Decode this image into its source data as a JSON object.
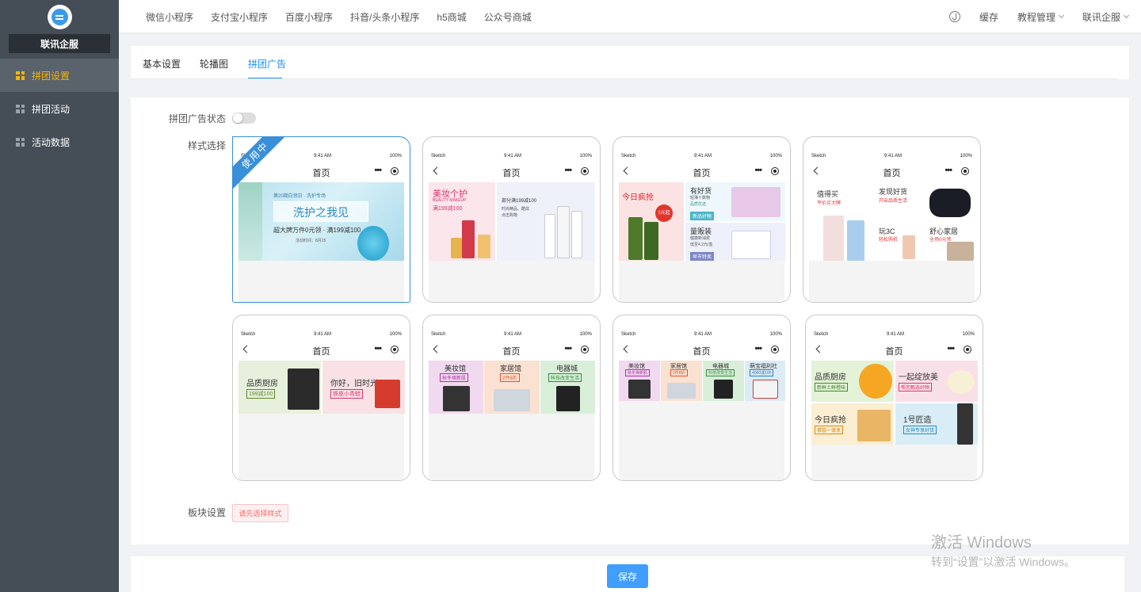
{
  "sidebar": {
    "brand": "联讯企服",
    "items": [
      {
        "label": "拼团设置",
        "icon": "grid-icon",
        "active": true
      },
      {
        "label": "拼团活动",
        "icon": "grid-icon",
        "active": false
      },
      {
        "label": "活动数据",
        "icon": "grid-icon",
        "active": false
      }
    ]
  },
  "topbar": {
    "tabs": [
      "微信小程序",
      "支付宝小程序",
      "百度小程序",
      "抖音/头条小程序",
      "h5商城",
      "公众号商城"
    ],
    "download_icon": "download-icon",
    "cache": "缓存",
    "tutorial": "教程管理",
    "user": "联讯企服"
  },
  "subtabs": [
    "基本设置",
    "轮播图",
    "拼团广告"
  ],
  "form": {
    "status_label": "拼团广告状态",
    "style_label": "样式选择",
    "block_label": "板块设置",
    "block_button": "请先选择样式"
  },
  "phone": {
    "carrier": "Sketch",
    "time": "9:41 AM",
    "battery": "100%",
    "title": "首页",
    "dots": "•••",
    "in_use": "使用中"
  },
  "styles": {
    "s1": {
      "top": "第20期白领日 · 洗护专场",
      "main": "洗护之我见",
      "sub": "超大牌万件0元领 · 满199减100",
      "small": "活动时间：8月25"
    },
    "s2": {
      "t1": "美妆个护",
      "t1en": "BEAUTY MAKEUP",
      "t1b": "满199减100",
      "t2": "部分满199减100",
      "t2b": "时尚精品、酷炫",
      "t2c": "点击购物"
    },
    "s3": {
      "t1": "今日疯抢",
      "badge": "1元起",
      "t2": "有好货",
      "t2b": "轻薄十数物",
      "t2c": "品质优选",
      "t2tag": "新品好物",
      "t3": "量贩装",
      "t3b": "健康新消费",
      "t3c": "低至4.2元/盒",
      "t3tag": "早市特卖"
    },
    "s4": {
      "t1": "值得买",
      "t1b": "平价买大牌",
      "t2": "发现好货",
      "t2b": "开启品质生活",
      "t3": "玩3C",
      "t3b": "轻松购机",
      "t4": "舒心家居",
      "t4b": "全场0元领"
    },
    "s5": {
      "t1": "品质厨房",
      "t1tag": "199减100",
      "t2": "你好，旧时光",
      "t2tag": "铁皮小青蛙"
    },
    "s6": {
      "t1": "美妆馆",
      "t1tag": "秋冬焕新肌",
      "t2": "家居馆",
      "t2tag": "2件8折",
      "t3": "电器城",
      "t3tag": "科技改变生活"
    },
    "s7": {
      "t1": "美妆馆",
      "t1tag": "秋冬焕新肌",
      "t2": "家居馆",
      "t2tag": "2件8折",
      "t3": "电器城",
      "t3tag": "科技改变生活",
      "t4": "萌宝福利社",
      "t4tag": "4000减100"
    },
    "s8": {
      "t1": "品质厨房",
      "t1tag": "新鲜土鲜橙味",
      "t2": "一起绽放美",
      "t2tag": "帮您甄选好物",
      "t3": "今日疯抢",
      "t3tag": "蛋糕一律享",
      "t4": "1号匠造",
      "t4tag": "女神专享好货"
    }
  },
  "footer": {
    "save": "保存"
  },
  "watermark": {
    "line1": "激活 Windows",
    "line2": "转到“设置”以激活 Windows。"
  },
  "colors": {
    "sidebar_bg": "#454d57",
    "accent": "#1890ff",
    "active_nav": "#f7b500",
    "save_btn": "#409eff"
  }
}
